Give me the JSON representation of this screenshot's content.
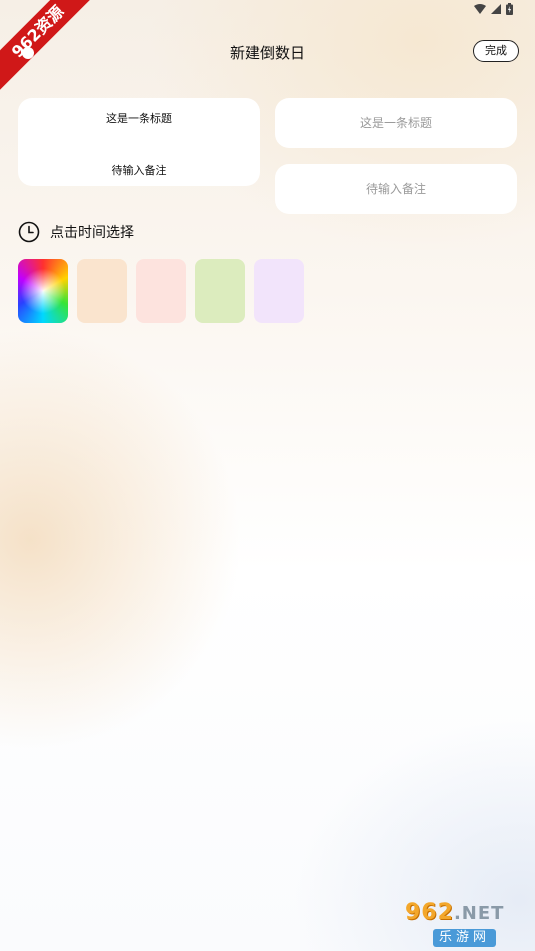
{
  "ribbon": {
    "text": "962资源"
  },
  "header": {
    "title": "新建倒数日",
    "done_label": "完成"
  },
  "preview": {
    "title": "这是一条标题",
    "note": "待输入备注"
  },
  "form": {
    "title_placeholder": "这是一条标题",
    "note_placeholder": "待输入备注"
  },
  "time": {
    "label": "点击时间选择"
  },
  "swatches": [
    {
      "name": "rainbow",
      "color": ""
    },
    {
      "name": "peach",
      "color": "#fae4ce"
    },
    {
      "name": "pink",
      "color": "#fde3de"
    },
    {
      "name": "green",
      "color": "#dcecbe"
    },
    {
      "name": "lavender",
      "color": "#f2e4fb"
    }
  ],
  "watermark": {
    "top": "962",
    "top_suffix": ".NET",
    "bottom": "乐游网"
  }
}
